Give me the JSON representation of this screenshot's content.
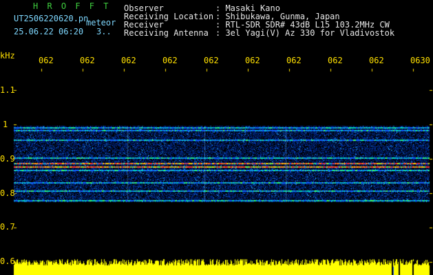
{
  "header": {
    "logo": "H R O F F T",
    "filename": "UT2506220620.pn",
    "mode": "meteor",
    "datetime": "25.06.22 06:20",
    "count": "3..",
    "info": [
      {
        "label": "Observer",
        "value": ": Masaki Kano"
      },
      {
        "label": "Receiving Location",
        "value": ": Shibukawa, Gunma, Japan"
      },
      {
        "label": "Receiver",
        "value": ": RTL-SDR SDR# 43dB L15 103.2MHz CW"
      },
      {
        "label": "Receiving Antenna",
        "value": ": 3el Yagi(V) Az 330 for Vladivostok"
      }
    ]
  },
  "chart_data": {
    "type": "heatmap",
    "ylabel": "kHz",
    "y_ticks": [
      "1.1",
      "1",
      "0.9",
      "0.8",
      "0.7",
      "0.6"
    ],
    "x_ticks": [
      "062",
      "062",
      "062",
      "062",
      "062",
      "062",
      "062",
      "062",
      "062",
      "0630"
    ],
    "bands_khz": [
      0.993,
      0.985,
      0.956,
      0.905,
      0.888,
      0.878,
      0.833,
      0.808,
      0.78
    ],
    "colors": {
      "bg": "#000000",
      "noise": "#0030b0",
      "mid": "#00c8d0",
      "strong": "#ff3030",
      "power": "#ffff00",
      "text": "#ffe000"
    }
  }
}
